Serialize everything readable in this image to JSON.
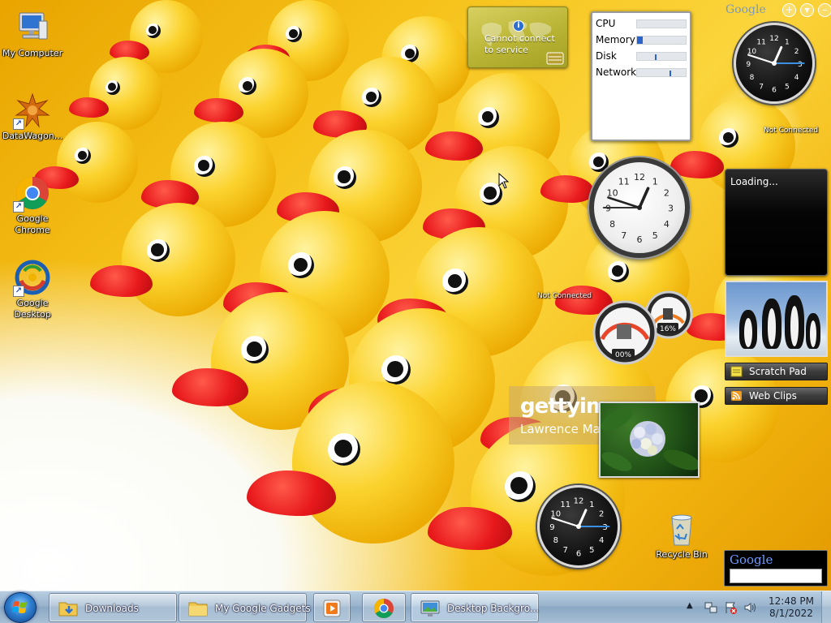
{
  "desktop": {
    "icons": [
      {
        "label": "My Computer",
        "icon": "computer-icon"
      },
      {
        "label": "DataWagon...",
        "icon": "datawagon-icon"
      },
      {
        "label": "Google Chrome",
        "icon": "chrome-icon"
      },
      {
        "label": "Google Desktop",
        "icon": "google-desktop-icon"
      },
      {
        "label": "Recycle Bin",
        "icon": "recycle-bin-icon"
      }
    ]
  },
  "gadgets": {
    "weather": {
      "message": "Cannot connect to service"
    },
    "meter": {
      "rows": [
        {
          "label": "CPU",
          "level": 0
        },
        {
          "label": "Memory",
          "level": 0.12
        },
        {
          "label": "Disk",
          "level": 0.36
        },
        {
          "label": "Network",
          "level": 0.66
        }
      ]
    },
    "clock_status": {
      "label": "Not Connected"
    },
    "clock_mid_status": {
      "label": "Not Connected"
    },
    "feed": {
      "text": "Loading..."
    },
    "cpu_meter": {
      "left_value": "00%",
      "right_value": "16%"
    },
    "side_buttons": [
      {
        "label": "Scratch Pad"
      },
      {
        "label": "Web Clips"
      }
    ],
    "getty": {
      "brand": "gettyim",
      "credit": "Lawrence Ma"
    },
    "google_search": {
      "logo": "Google",
      "value": ""
    },
    "top_logo": "Google"
  },
  "taskbar": {
    "items": [
      {
        "label": "Downloads"
      },
      {
        "label": "My Google Gadgets"
      },
      {
        "label": ""
      },
      {
        "label": ""
      },
      {
        "label": "Desktop Backgro..."
      }
    ],
    "clock": {
      "time": "12:48 PM",
      "date": "8/1/2022"
    }
  },
  "colors": {
    "taskbar": "#9ab4cc",
    "accent_blue": "#2a63c9",
    "duck_yellow": "#fbd22c",
    "beak_red": "#e8191c"
  }
}
